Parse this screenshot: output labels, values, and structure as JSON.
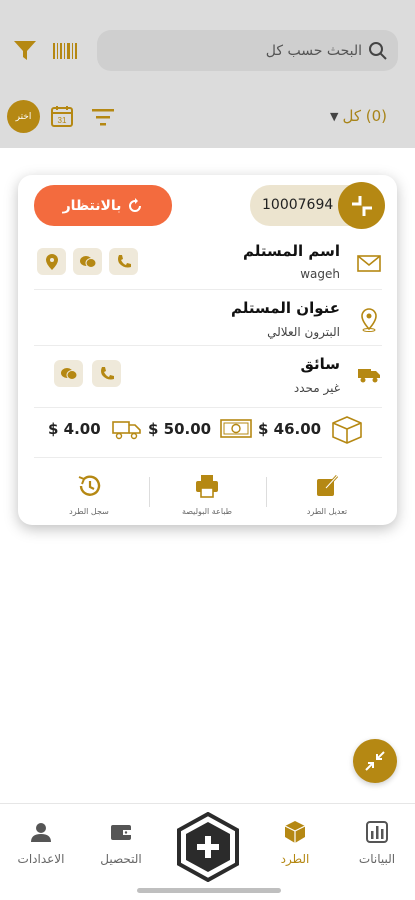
{
  "search": {
    "placeholder": "البحث حسب كل"
  },
  "toolbar": {
    "choose_label": "اختر",
    "count_label": "(0) كل",
    "calendar_day": "31"
  },
  "card": {
    "status_label": "بالانتظار",
    "parcel_id": "10007694",
    "recipient_name_title": "اسم المستلم",
    "recipient_name_value": "wageh",
    "recipient_address_title": "عنوان المستلم",
    "recipient_address_value": "البترون العلالي",
    "driver_title": "سائق",
    "driver_value": "غير محدد",
    "amount_parcel": "46.00",
    "amount_delivery": "50.00",
    "amount_total": "4.00",
    "currency": "$",
    "actions": {
      "edit_label": "تعديل الطرد",
      "print_label": "طباعة البوليصة",
      "history_label": "سجل الطرد"
    }
  },
  "nav": {
    "data_label": "البيانات",
    "parcels_label": "الطرد",
    "collection_label": "التحصيل",
    "settings_label": "الاعدادات"
  },
  "colors": {
    "accent": "#b58813",
    "status": "#f36b3e",
    "topbar": "#dcdcdc"
  },
  "icons": [
    "filter-icon",
    "barcode-icon",
    "search-icon",
    "calendar-icon",
    "sort-icon",
    "collapse-icon",
    "envelope-icon",
    "location-pin-icon",
    "truck-icon",
    "phone-icon",
    "whatsapp-icon",
    "box-icon",
    "cash-icon",
    "edit-icon",
    "print-icon",
    "history-icon",
    "chart-icon",
    "parcel-icon",
    "wallet-icon",
    "user-icon",
    "plus-icon"
  ]
}
